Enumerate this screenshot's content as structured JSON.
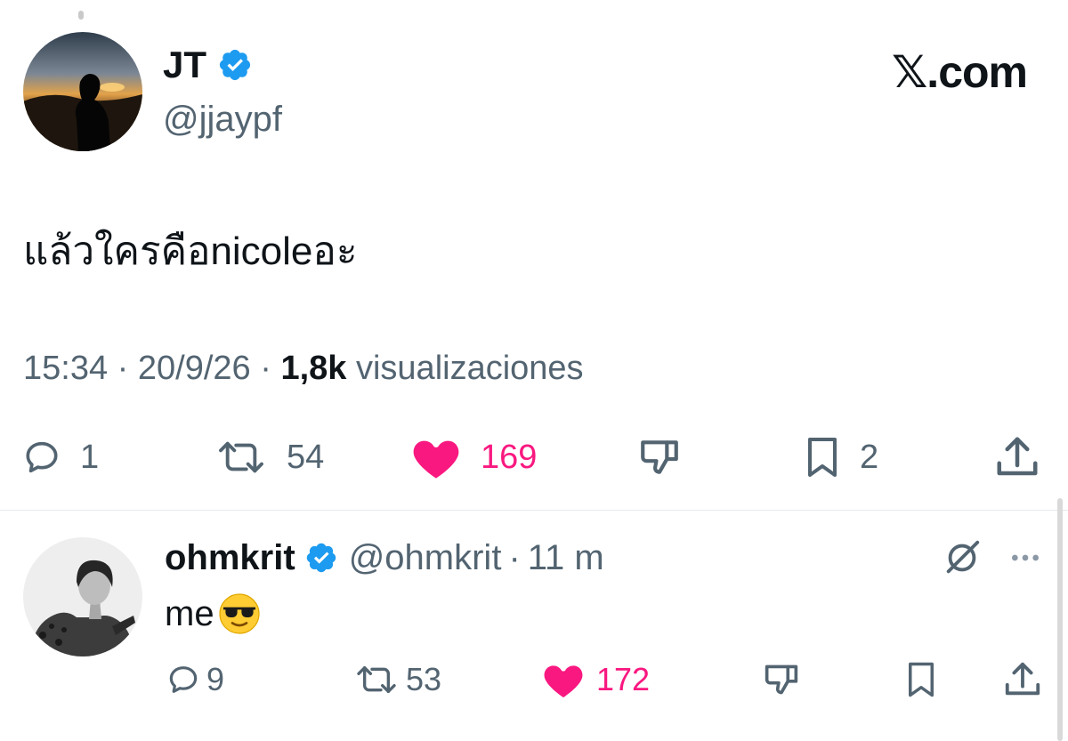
{
  "brand": "𝕏.com",
  "main_tweet": {
    "author_name": "JT",
    "author_handle": "@jjaypf",
    "text": "แล้วใครคือnicoleอะ",
    "time": "15:34",
    "date": "20/9/26",
    "views_count": "1,8k",
    "views_label": "visualizaciones",
    "replies": "1",
    "retweets": "54",
    "likes": "169",
    "bookmarks": "2"
  },
  "reply": {
    "author_name": "ohmkrit",
    "author_handle": "@ohmkrit",
    "time": "11 m",
    "text": "me",
    "replies": "9",
    "retweets": "53",
    "likes": "172"
  },
  "colors": {
    "verified": "#1d9bf0",
    "like": "#f91880",
    "muted": "#536471",
    "text": "#0f1419"
  },
  "icons": [
    "verified-badge-icon",
    "reply-icon",
    "retweet-icon",
    "like-icon",
    "dislike-icon",
    "bookmark-icon",
    "share-icon",
    "grok-icon",
    "more-icon",
    "sunglasses-emoji-icon"
  ]
}
